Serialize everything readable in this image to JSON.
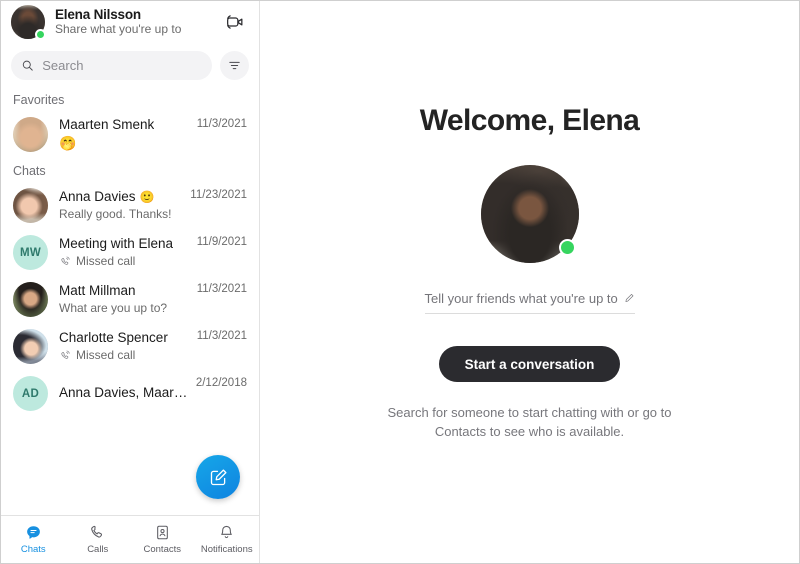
{
  "sidebar": {
    "header": {
      "user_name": "Elena Nilsson",
      "mood": "Share what you're up to",
      "avatar_name": "elena-avatar",
      "presence": "online",
      "meet_now_icon": "video-camera-icon"
    },
    "search": {
      "placeholder": "Search",
      "value": "",
      "icon": "search-icon",
      "filter_icon": "filter-icon"
    },
    "sections": [
      {
        "label": "Favorites",
        "items": [
          {
            "name": "Maarten Smenk",
            "preview": "🤭",
            "preview_is_emoji": true,
            "date": "11/3/2021",
            "avatar_kind": "photo",
            "avatar_class": "ph-maarten",
            "name_emoji": ""
          }
        ]
      },
      {
        "label": "Chats",
        "items": [
          {
            "name": "Anna Davies",
            "name_emoji": "🙂",
            "preview": "Really good. Thanks!",
            "preview_is_emoji": false,
            "date": "11/23/2021",
            "avatar_kind": "photo",
            "avatar_class": "ph-anna"
          },
          {
            "name": "Meeting with Elena",
            "name_emoji": "",
            "preview": "Missed call",
            "preview_is_emoji": false,
            "preview_icon": "missed-call-icon",
            "date": "11/9/2021",
            "avatar_kind": "initials",
            "initials": "MW",
            "avatar_bg": "#bde9de",
            "avatar_fg": "#2f7a6c"
          },
          {
            "name": "Matt Millman",
            "name_emoji": "",
            "preview": "What are you up to?",
            "preview_is_emoji": false,
            "date": "11/3/2021",
            "avatar_kind": "photo",
            "avatar_class": "ph-matt"
          },
          {
            "name": "Charlotte Spencer",
            "name_emoji": "",
            "preview": "Missed call",
            "preview_is_emoji": false,
            "preview_icon": "missed-call-icon",
            "date": "11/3/2021",
            "avatar_kind": "photo",
            "avatar_class": "ph-charlotte"
          },
          {
            "name": "Anna Davies, Maarten...",
            "name_emoji": "",
            "preview": "",
            "preview_is_emoji": false,
            "date": "2/12/2018",
            "avatar_kind": "initials",
            "initials": "AD",
            "avatar_bg": "#bde9de",
            "avatar_fg": "#2f7a6c"
          }
        ]
      }
    ],
    "fab": {
      "icon": "new-chat-compose-icon",
      "color": "#1290e0"
    },
    "bottom_nav": {
      "active": "Chats",
      "active_color": "#1790e0",
      "items": [
        {
          "label": "Chats",
          "icon": "chat-bubble-icon",
          "active": true
        },
        {
          "label": "Calls",
          "icon": "phone-icon",
          "active": false
        },
        {
          "label": "Contacts",
          "icon": "contacts-book-icon",
          "active": false
        },
        {
          "label": "Notifications",
          "icon": "bell-icon",
          "active": false
        }
      ]
    }
  },
  "main": {
    "title": "Welcome, Elena",
    "avatar_name": "elena-large-avatar",
    "presence": "online",
    "presence_color": "#36d55f",
    "mood_input": {
      "placeholder": "Tell your friends what you're up to",
      "value": "",
      "icon": "pencil-edit-icon"
    },
    "cta_label": "Start a conversation",
    "cta_color": "#2b2b2f",
    "hint": "Search for someone to start chatting with or go to Contacts to see who is available."
  }
}
